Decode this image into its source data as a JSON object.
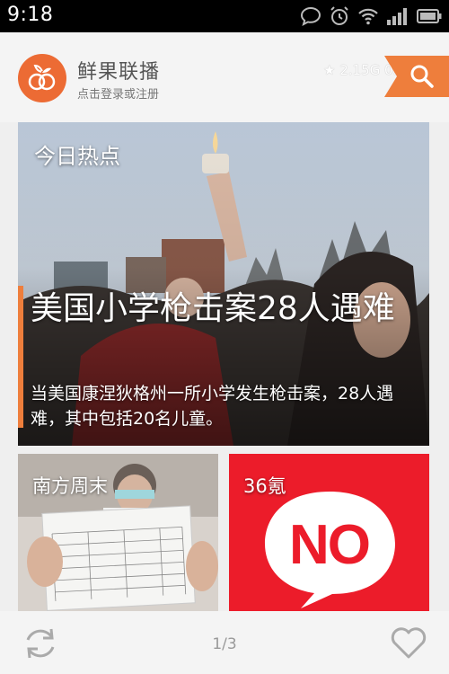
{
  "status_bar": {
    "time": "9:18",
    "icons": [
      "chat-icon",
      "alarm-icon",
      "wifi-icon",
      "signal-icon",
      "battery-icon"
    ]
  },
  "header": {
    "app_name": "鲜果联播",
    "login_text": "点击登录或注册",
    "speed_text": "2.15G 0.1K/S",
    "star_glyph": "★",
    "accent_color": "#ee7e3c",
    "logo_color": "#ec6b34"
  },
  "hero": {
    "section_label": "今日热点",
    "title": "美国小学枪击案28人遇难",
    "summary": "当美国康涅狄格州一所小学发生枪击案，28人遇难，其中包括20名儿童。"
  },
  "tiles": [
    {
      "label": "南方周末",
      "icon": "document-photo"
    },
    {
      "label": "36氪",
      "badge_text": "NO",
      "background": "#ec1c2a"
    }
  ],
  "bottom_bar": {
    "page_indicator": "1/3",
    "icons": [
      "refresh-icon",
      "heart-icon"
    ]
  }
}
